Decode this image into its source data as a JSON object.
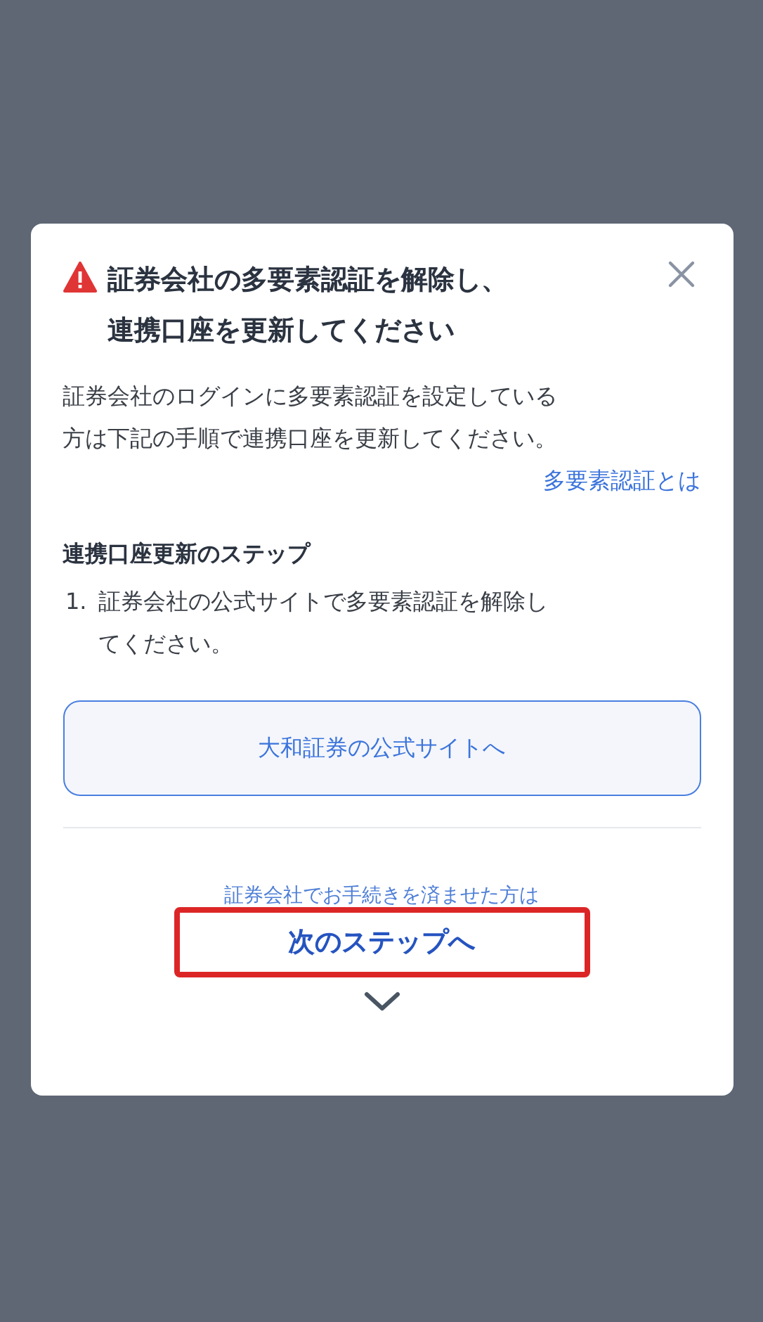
{
  "dialog": {
    "title_lines": [
      "証券会社の多要素認証を解除し、",
      "連携口座を更新してください"
    ],
    "description_lines": [
      "証券会社のログインに多要素認証を設定している",
      "方は下記の手順で連携口座を更新してください。"
    ],
    "help_link": "多要素認証とは",
    "steps_heading": "連携口座更新のステップ",
    "steps": [
      {
        "number": "1.",
        "lines": [
          "証券会社の公式サイトで多要素認証を解除し",
          "てください。"
        ]
      }
    ],
    "site_button": "大和証券の公式サイトへ",
    "next_hint": "証券会社でお手続きを済ませた方は",
    "next_link": {
      "label": "次のステップへ",
      "highlighted": true
    }
  }
}
